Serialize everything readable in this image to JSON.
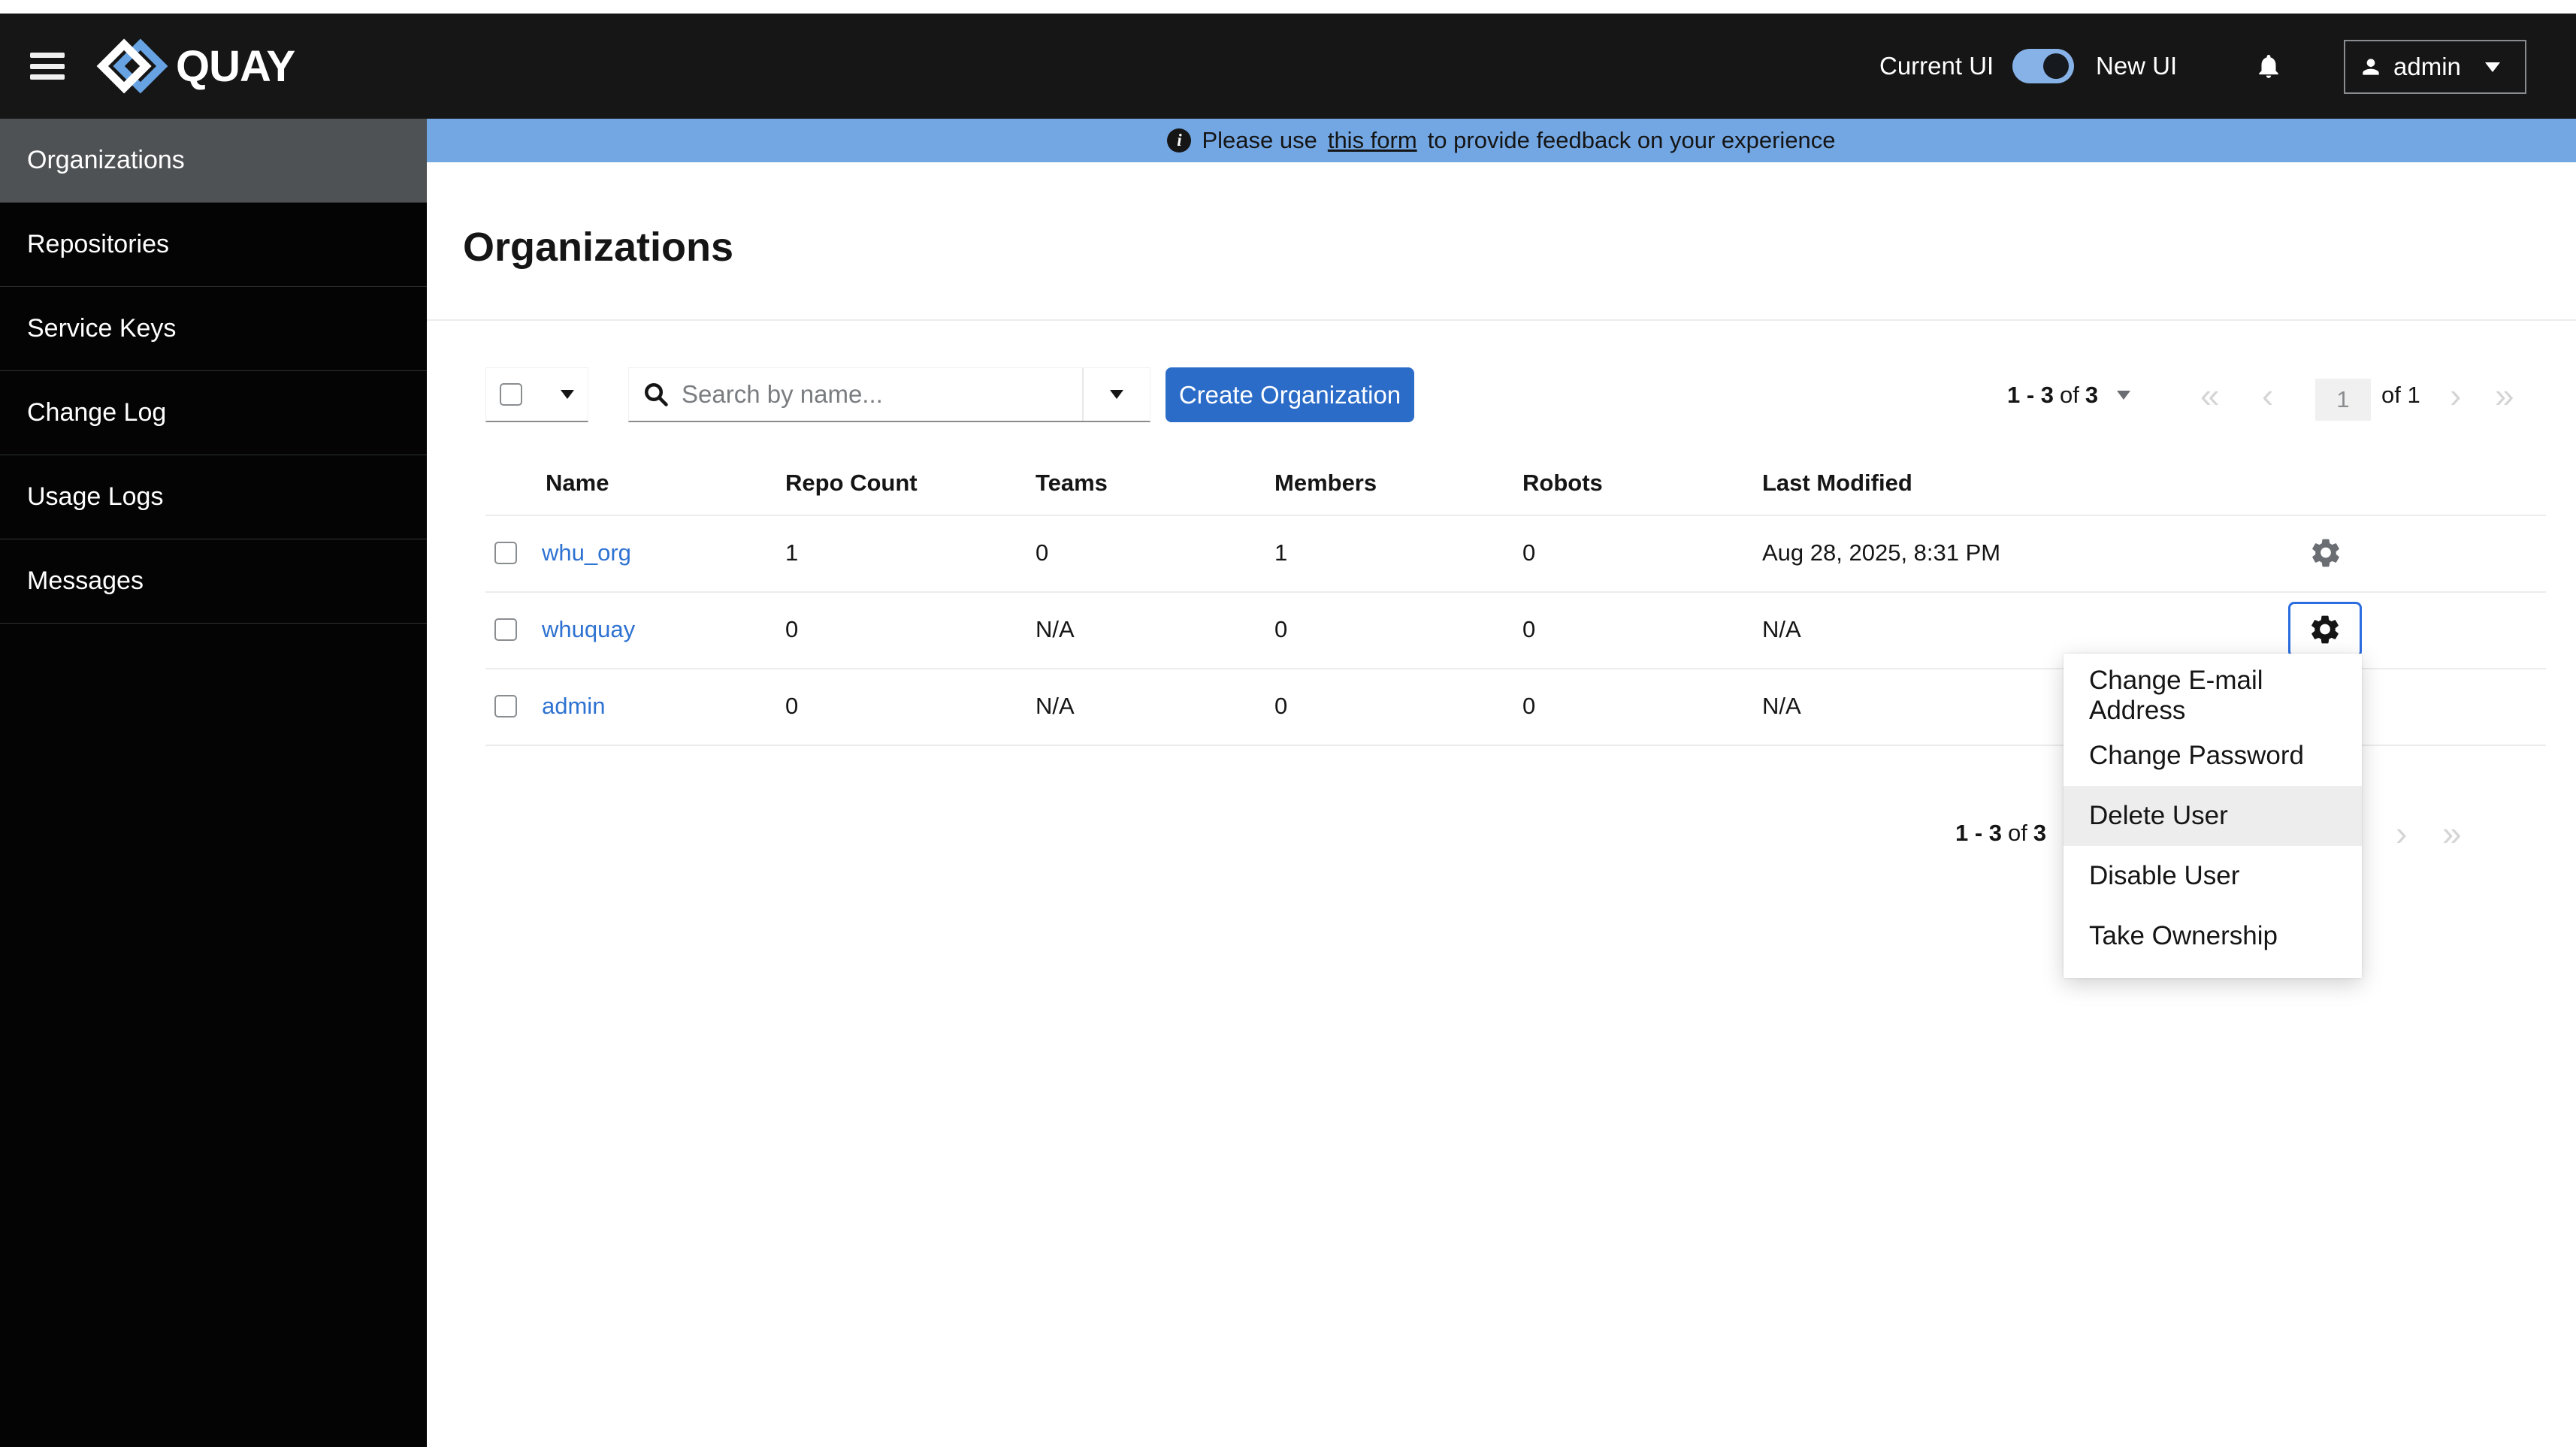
{
  "header": {
    "brand": "QUAY",
    "ui_toggle": {
      "left_label": "Current UI",
      "right_label": "New UI",
      "state": "on"
    },
    "user_menu": {
      "username": "admin"
    }
  },
  "banner": {
    "prefix": "Please use",
    "link": "this form",
    "suffix": "to provide feedback on your experience",
    "info_icon": "i"
  },
  "sidebar": {
    "items": [
      {
        "label": "Organizations",
        "selected": true
      },
      {
        "label": "Repositories",
        "selected": false
      },
      {
        "label": "Service Keys",
        "selected": false
      },
      {
        "label": "Change Log",
        "selected": false
      },
      {
        "label": "Usage Logs",
        "selected": false
      },
      {
        "label": "Messages",
        "selected": false
      }
    ]
  },
  "page": {
    "title": "Organizations"
  },
  "toolbar": {
    "search": {
      "placeholder": "Search by name..."
    },
    "create_button": "Create Organization"
  },
  "pagination_top": {
    "range_start": "1 - 3",
    "of_word": "of",
    "total": "3",
    "current_page": "1",
    "page_of": "of 1",
    "first": "«",
    "prev": "‹",
    "next": "›",
    "last": "»"
  },
  "pagination_bottom": {
    "range_start": "1 - 3",
    "of_word": "of",
    "total": "3",
    "next": "›",
    "last": "»"
  },
  "table": {
    "columns": [
      "Name",
      "Repo Count",
      "Teams",
      "Members",
      "Robots",
      "Last Modified"
    ],
    "rows": [
      {
        "name": "whu_org",
        "repo_count": "1",
        "teams": "0",
        "members": "1",
        "robots": "0",
        "last_modified": "Aug 28, 2025, 8:31 PM"
      },
      {
        "name": "whuquay",
        "repo_count": "0",
        "teams": "N/A",
        "members": "0",
        "robots": "0",
        "last_modified": "N/A"
      },
      {
        "name": "admin",
        "repo_count": "0",
        "teams": "N/A",
        "members": "0",
        "robots": "0",
        "last_modified": "N/A"
      }
    ]
  },
  "user_actions_menu": {
    "items": [
      "Change E-mail Address",
      "Change Password",
      "Delete User",
      "Disable User",
      "Take Ownership"
    ],
    "highlighted": "Delete User"
  },
  "colors": {
    "banner_blue": "#73a7e3",
    "primary_button_blue": "#2b6cc8",
    "link_blue": "#2e72d2",
    "focus_blue": "#2b6de0",
    "toggle_blue": "#86b2e8",
    "selected_nav_gray": "#4f5255"
  }
}
